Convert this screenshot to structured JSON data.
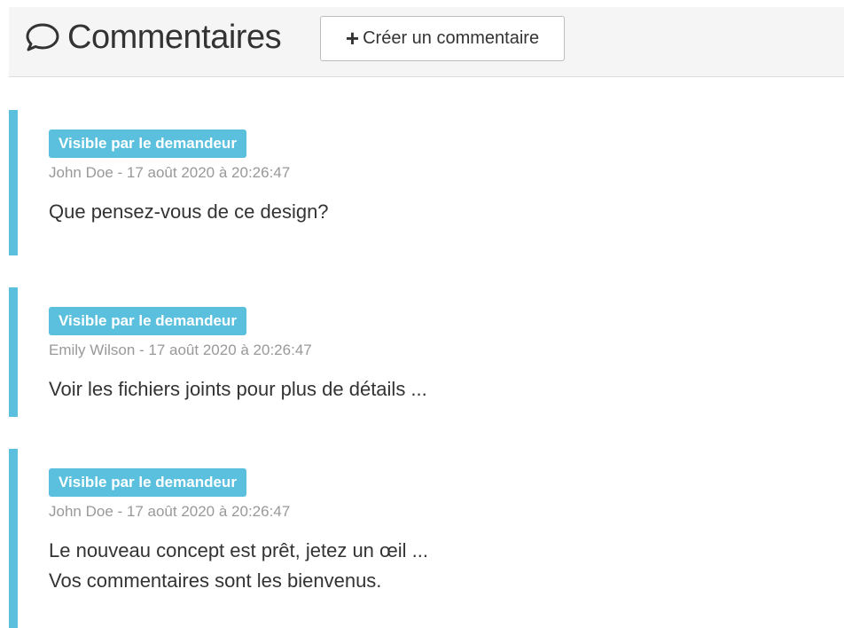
{
  "header": {
    "title": "Commentaires",
    "title_icon": "comment-bubble-icon",
    "create_button_label": "Créer un commentaire",
    "create_button_icon": "plus-icon"
  },
  "colors": {
    "accent": "#5bc0de",
    "header_bg": "#f5f5f5",
    "meta_text": "#999999",
    "body_text": "#333333"
  },
  "comments": [
    {
      "visibility": "Visible par le demandeur",
      "meta": "John Doe - 17 août 2020 à 20:26:47",
      "lines": [
        "Que pensez-vous de ce design?"
      ]
    },
    {
      "visibility": "Visible par le demandeur",
      "meta": "Emily Wilson - 17 août 2020 à 20:26:47",
      "lines": [
        "Voir les fichiers joints pour plus de détails ..."
      ]
    },
    {
      "visibility": "Visible par le demandeur",
      "meta": "John Doe - 17 août 2020 à 20:26:47",
      "lines": [
        "Le nouveau concept est prêt, jetez un œil ...",
        "Vos commentaires sont les bienvenus."
      ]
    }
  ]
}
